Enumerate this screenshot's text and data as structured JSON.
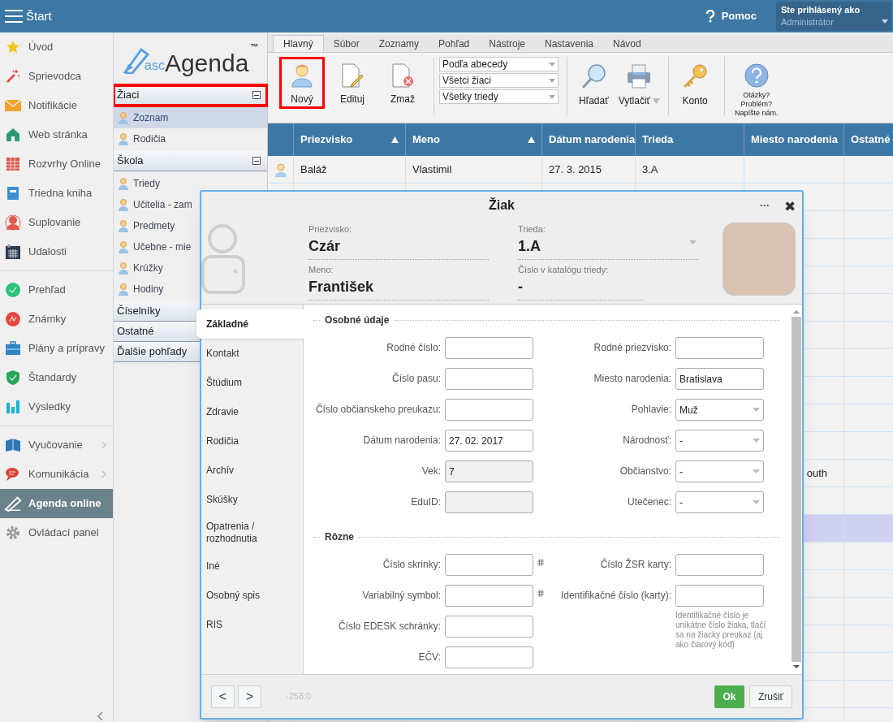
{
  "top_bar": {
    "title": "Štart",
    "help": "Pomoc",
    "user_label": "Ste prihlásený ako",
    "user": "Administrátor"
  },
  "nav": [
    {
      "items": [
        {
          "label": "Úvod",
          "selected": false,
          "submenu": false
        },
        {
          "label": "Sprievodca",
          "selected": false,
          "submenu": false
        },
        {
          "label": "Notifikácie",
          "selected": false,
          "submenu": false
        },
        {
          "label": "Web stránka",
          "selected": false,
          "submenu": false
        },
        {
          "label": "Rozvrhy Online",
          "selected": false,
          "submenu": false
        },
        {
          "label": "Triedna kniha",
          "selected": false,
          "submenu": false
        },
        {
          "label": "Suplovanie",
          "selected": false,
          "submenu": false
        },
        {
          "label": "Udalosti",
          "selected": false,
          "submenu": false
        }
      ]
    },
    {
      "items": [
        {
          "label": "Prehľad",
          "selected": false,
          "submenu": false
        },
        {
          "label": "Známky",
          "selected": false,
          "submenu": false
        },
        {
          "label": "Plány a prípravy",
          "selected": false,
          "submenu": false
        },
        {
          "label": "Štandardy",
          "selected": false,
          "submenu": false
        },
        {
          "label": "Výsledky",
          "selected": false,
          "submenu": false
        }
      ]
    },
    {
      "items": [
        {
          "label": "Vyučovanie",
          "selected": false,
          "submenu": true
        },
        {
          "label": "Komunikácia",
          "selected": false,
          "submenu": true
        },
        {
          "label": "Agenda online",
          "selected": true,
          "submenu": false
        },
        {
          "label": "Ovládací panel",
          "selected": false,
          "submenu": false
        }
      ]
    }
  ],
  "logo": {
    "prefix": "asc",
    "name": "Agenda",
    "mark": "™"
  },
  "tree": [
    {
      "label": "Žiaci",
      "expanded": true,
      "highlighted": true,
      "items": [
        {
          "label": "Zoznam",
          "selected": true
        },
        {
          "label": "Rodičia",
          "selected": false
        }
      ]
    },
    {
      "label": "Škola",
      "expanded": true,
      "highlighted": false,
      "items": [
        {
          "label": "Triedy",
          "selected": false
        },
        {
          "label": "Učitelia - zam",
          "selected": false
        },
        {
          "label": "Predmety",
          "selected": false
        },
        {
          "label": "Učebne - mie",
          "selected": false
        },
        {
          "label": "Krúžky",
          "selected": false
        },
        {
          "label": "Hodiny",
          "selected": false
        }
      ]
    },
    {
      "label": "Číselníky",
      "highlighted": false
    },
    {
      "label": "Ostatné",
      "highlighted": false
    },
    {
      "label": "Ďalšie pohľady",
      "highlighted": false
    }
  ],
  "ribbon": {
    "tabs": [
      {
        "label": "Hlavný",
        "selected": true
      },
      {
        "label": "Súbor",
        "selected": false
      },
      {
        "label": "Zoznamy",
        "selected": false
      },
      {
        "label": "Pohľad",
        "selected": false
      },
      {
        "label": "Nástroje",
        "selected": false
      },
      {
        "label": "Nastavenia",
        "selected": false
      },
      {
        "label": "Návod",
        "selected": false
      }
    ],
    "actions": [
      {
        "label": "Nový",
        "highlighted": true
      },
      {
        "label": "Edituj",
        "highlighted": false
      },
      {
        "label": "Zmaž",
        "highlighted": false
      }
    ],
    "filters": [
      "Podľa abecedy",
      "Všetci žiaci",
      "Všetky triedy"
    ],
    "tools": [
      {
        "label": "Hľadať",
        "menu": false
      },
      {
        "label": "Vytlačiť",
        "menu": true
      },
      {
        "label": "Konto",
        "menu": false
      }
    ],
    "help": [
      "Otázky?",
      "Problém?",
      "Napíšte nám."
    ]
  },
  "table": {
    "columns": [
      {
        "label": "Priezvisko",
        "sorted": true
      },
      {
        "label": "Meno",
        "sorted": true
      },
      {
        "label": "Dátum narodenia"
      },
      {
        "label": "Trieda"
      },
      {
        "label": "Miesto narodenia"
      },
      {
        "label": "Ostatné"
      }
    ],
    "rows": [
      {
        "selected": false,
        "priezvisko": "Baláž",
        "meno": "Vlastimil",
        "datum_narodenia": "27. 3. 2015",
        "trieda": "3.A"
      },
      {
        "selected": false
      },
      {
        "selected": false
      },
      {
        "selected": false
      },
      {
        "selected": false
      },
      {
        "selected": false
      },
      {
        "selected": false
      },
      {
        "selected": false
      },
      {
        "selected": false
      },
      {
        "selected": false
      },
      {
        "selected": false
      },
      {
        "selected": false,
        "miesto_narodenia": "outh"
      },
      {
        "selected": false
      },
      {
        "selected": true
      },
      {
        "selected": false
      },
      {
        "selected": false
      },
      {
        "selected": false
      },
      {
        "selected": false
      },
      {
        "selected": false
      },
      {
        "selected": false
      },
      {
        "selected": false
      }
    ]
  },
  "dialog": {
    "title": "Žiak",
    "menu": "···",
    "close": "✖",
    "header": [
      {
        "label": "Priezvisko:",
        "value": "Czár",
        "dropdown": false
      },
      {
        "label": "Trieda:",
        "value": "1.A",
        "dropdown": true
      },
      {
        "label": "Meno:",
        "value": "František",
        "dropdown": false
      },
      {
        "label": "Číslo v katalógu triedy:",
        "value": "-",
        "dropdown": false
      }
    ],
    "tabs": [
      {
        "label": "Základné",
        "selected": true
      },
      {
        "label": "Kontakt",
        "selected": false
      },
      {
        "label": "Štúdium",
        "selected": false
      },
      {
        "label": "Zdravie",
        "selected": false
      },
      {
        "label": "Rodičia",
        "selected": false
      },
      {
        "label": "Archív",
        "selected": false
      },
      {
        "label": "Skúšky",
        "selected": false
      },
      {
        "label": "Opatrenia / rozhodnutia",
        "selected": false
      },
      {
        "label": "Iné",
        "selected": false
      },
      {
        "label": "Osobný spis",
        "selected": false
      },
      {
        "label": "RIS",
        "selected": false
      }
    ],
    "sections": [
      {
        "title": "Osobné údaje",
        "left": [
          {
            "label": "Rodné číslo:",
            "kind": "text",
            "hash": false
          },
          {
            "label": "Číslo pasu:",
            "kind": "text",
            "hash": false
          },
          {
            "label": "Číslo občianskeho preukazu:",
            "kind": "text",
            "hash": false
          },
          {
            "label": "Dátum narodenia:",
            "kind": "text",
            "value": "27. 02. 2017",
            "hash": false
          },
          {
            "label": "Vek:",
            "kind": "readonly",
            "value": "7",
            "hash": false
          },
          {
            "label": "EduID:",
            "kind": "readonly",
            "hash": false
          }
        ],
        "right": [
          {
            "label": "Rodné priezvisko:",
            "kind": "text",
            "hash": false
          },
          {
            "label": "Miesto narodenia:",
            "kind": "text",
            "value": "Bratislava",
            "hash": false
          },
          {
            "label": "Pohlavie:",
            "kind": "select",
            "value": "Muž",
            "hash": false
          },
          {
            "label": "Národnosť:",
            "kind": "select",
            "value": "-",
            "hash": false
          },
          {
            "label": "Občianstvo:",
            "kind": "select",
            "value": "-",
            "hash": false
          },
          {
            "label": "Utečenec:",
            "kind": "select",
            "value": "-",
            "hash": false
          }
        ]
      },
      {
        "title": "Rôzne",
        "left": [
          {
            "label": "Číslo skrinky:",
            "kind": "text",
            "hash": true
          },
          {
            "label": "Variabilný symbol:",
            "kind": "text",
            "hash": true
          },
          {
            "label": "Číslo EDESK schránky:",
            "kind": "text",
            "hash": false
          },
          {
            "label": "EČV:",
            "kind": "text",
            "hash": false
          }
        ],
        "right": [
          {
            "label": "Číslo ŽSR karty:",
            "kind": "text",
            "hash": false
          },
          {
            "label": "Identifikačné číslo (karty):",
            "kind": "text",
            "hash": false,
            "note": "Identifikačné číslo je unikátne číslo žiaka, tlačí sa na žiacky preukaz (aj ako čiarový kód)"
          }
        ]
      }
    ],
    "footer": {
      "prev": "<",
      "next": ">",
      "position": "-258:0",
      "ok": "Ok",
      "cancel": "Zrušiť"
    }
  }
}
